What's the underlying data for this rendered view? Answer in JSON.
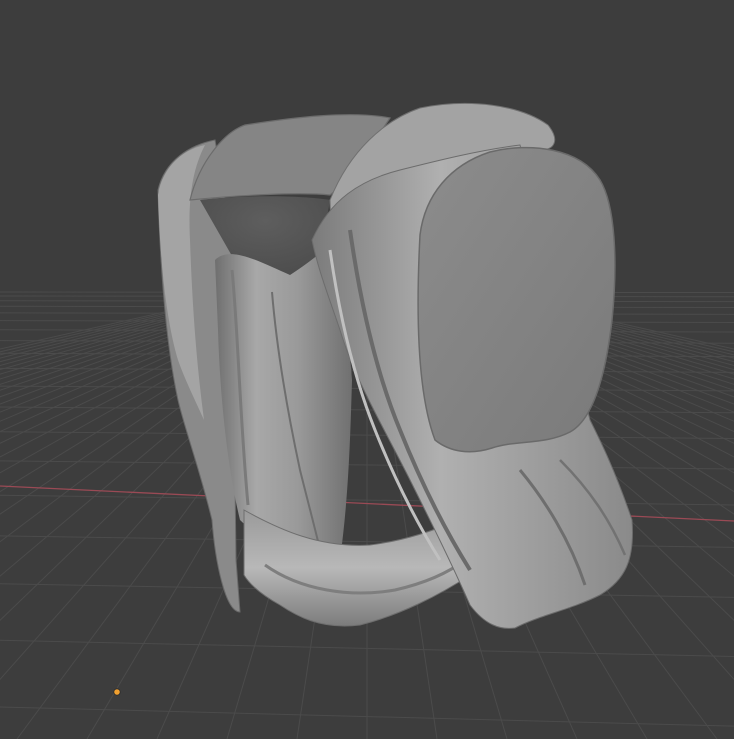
{
  "viewport": {
    "editor": "3D Viewport",
    "shading": "solid",
    "colors": {
      "background": "#3d3d3d",
      "grid_line": "#4b4b4b",
      "x_axis": "#9a4a55",
      "mesh_base": "#8e8e8e",
      "mesh_highlight": "#b4b4b4",
      "mesh_shadow": "#5c5c5c",
      "origin_point": "#f0a030"
    }
  },
  "scene": {
    "object": {
      "icon": "sculpted-mesh",
      "description_visible": false
    },
    "grid_floor_visible": true,
    "x_axis_visible": true,
    "object_origin_visible": true
  }
}
